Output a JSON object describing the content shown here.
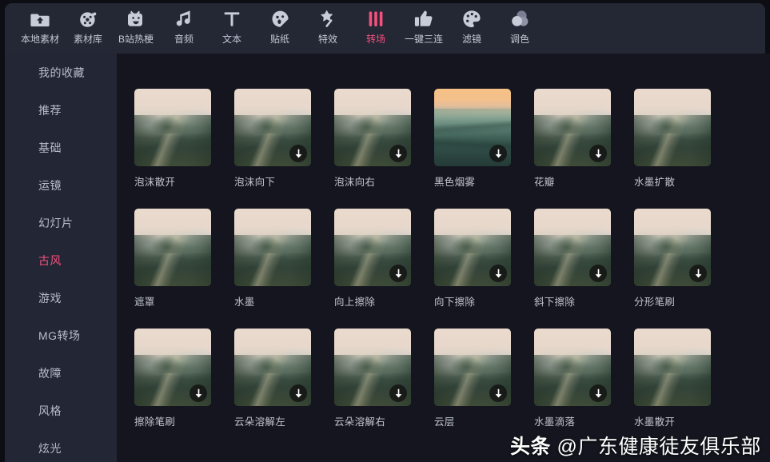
{
  "colors": {
    "accent": "#f5507d",
    "toolbar_bg": "#242734",
    "sidebar_bg": "#232634",
    "content_bg": "#14151e",
    "page_bg": "#0d0d14",
    "text": "#c2c6d2"
  },
  "toolbar": {
    "items": [
      {
        "label": "本地素材",
        "icon": "folder-upload-icon",
        "active": false
      },
      {
        "label": "素材库",
        "icon": "film-reel-icon",
        "active": false
      },
      {
        "label": "B站热梗",
        "icon": "bilibili-tv-icon",
        "active": false
      },
      {
        "label": "音频",
        "icon": "music-note-icon",
        "active": false
      },
      {
        "label": "文本",
        "icon": "text-t-icon",
        "active": false
      },
      {
        "label": "贴纸",
        "icon": "sticker-face-icon",
        "active": false
      },
      {
        "label": "特效",
        "icon": "magic-wand-icon",
        "active": false
      },
      {
        "label": "转场",
        "icon": "transition-bars-icon",
        "active": true
      },
      {
        "label": "一键三连",
        "icon": "thumbs-up-icon",
        "active": false
      },
      {
        "label": "滤镜",
        "icon": "palette-icon",
        "active": false
      },
      {
        "label": "调色",
        "icon": "color-circles-icon",
        "active": false
      }
    ]
  },
  "sidebar": {
    "items": [
      {
        "label": "我的收藏",
        "active": false
      },
      {
        "label": "推荐",
        "active": false
      },
      {
        "label": "基础",
        "active": false
      },
      {
        "label": "运镜",
        "active": false
      },
      {
        "label": "幻灯片",
        "active": false
      },
      {
        "label": "古风",
        "active": true
      },
      {
        "label": "游戏",
        "active": false
      },
      {
        "label": "MG转场",
        "active": false
      },
      {
        "label": "故障",
        "active": false
      },
      {
        "label": "风格",
        "active": false
      },
      {
        "label": "炫光",
        "active": false
      }
    ]
  },
  "grid": {
    "cards": [
      {
        "label": "泡沫散开",
        "thumb": "peak",
        "download": false
      },
      {
        "label": "泡沫向下",
        "thumb": "peak",
        "download": true
      },
      {
        "label": "泡沫向右",
        "thumb": "peak",
        "download": true
      },
      {
        "label": "黑色烟雾",
        "thumb": "sunset",
        "download": true
      },
      {
        "label": "花瓣",
        "thumb": "peak",
        "download": true
      },
      {
        "label": "水墨扩散",
        "thumb": "peak",
        "download": false
      },
      {
        "label": "遮罩",
        "thumb": "peak",
        "download": false
      },
      {
        "label": "水墨",
        "thumb": "peak",
        "download": false
      },
      {
        "label": "向上擦除",
        "thumb": "peak",
        "download": true
      },
      {
        "label": "向下擦除",
        "thumb": "peak",
        "download": true
      },
      {
        "label": "斜下擦除",
        "thumb": "peak",
        "download": true
      },
      {
        "label": "分形笔刷",
        "thumb": "peak",
        "download": true
      },
      {
        "label": "擦除笔刷",
        "thumb": "peak",
        "download": true
      },
      {
        "label": "云朵溶解左",
        "thumb": "peak",
        "download": true
      },
      {
        "label": "云朵溶解右",
        "thumb": "peak",
        "download": true
      },
      {
        "label": "云层",
        "thumb": "peak",
        "download": true
      },
      {
        "label": "水墨滴落",
        "thumb": "peak",
        "download": true
      },
      {
        "label": "水墨散开",
        "thumb": "peak",
        "download": false
      }
    ]
  },
  "watermark": {
    "prefix": "头条",
    "handle": "@广东健康徒友俱乐部"
  }
}
